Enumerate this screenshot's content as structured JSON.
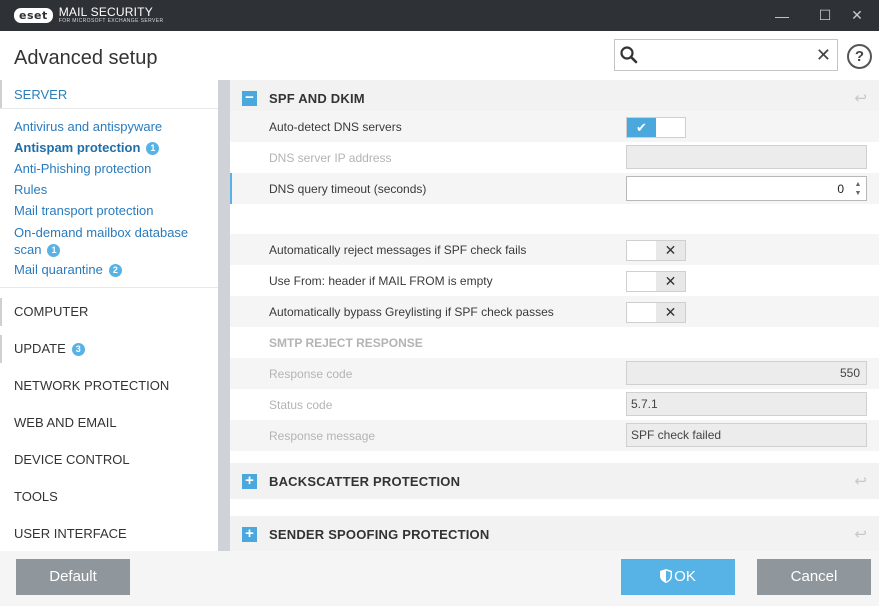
{
  "titlebar": {
    "brand": "eset",
    "product": "MAIL SECURITY",
    "product_sub": "FOR MICROSOFT EXCHANGE SERVER",
    "minimize_glyph": "—",
    "maximize_glyph": "☐",
    "close_glyph": "✕"
  },
  "header": {
    "title": "Advanced setup",
    "search_value": "",
    "search_clear_glyph": "✕",
    "help_glyph": "?"
  },
  "sidebar": {
    "sections": [
      {
        "label": "SERVER",
        "active": true
      },
      {
        "label": "COMPUTER"
      },
      {
        "label": "UPDATE",
        "badge": "3"
      },
      {
        "label": "NETWORK PROTECTION"
      },
      {
        "label": "WEB AND EMAIL"
      },
      {
        "label": "DEVICE CONTROL"
      },
      {
        "label": "TOOLS"
      },
      {
        "label": "USER INTERFACE"
      }
    ],
    "server_items": [
      {
        "label": "Antivirus and antispyware"
      },
      {
        "label": "Antispam protection",
        "badge": "1",
        "selected": true
      },
      {
        "label": "Anti-Phishing protection"
      },
      {
        "label": "Rules"
      },
      {
        "label": "Mail transport protection"
      },
      {
        "label": "On-demand mailbox database",
        "label2": "scan",
        "badge": "1"
      },
      {
        "label": "Mail quarantine",
        "badge": "2"
      }
    ]
  },
  "main": {
    "spf": {
      "title": "SPF AND DKIM",
      "toggle_glyph": "−",
      "revert_glyph": "↩",
      "rows": {
        "auto_detect": {
          "label": "Auto-detect DNS servers",
          "state": "on"
        },
        "dns_ip": {
          "label": "DNS server IP address",
          "value": ""
        },
        "dns_timeout": {
          "label": "DNS query timeout (seconds)",
          "value": "0"
        },
        "reject_spf": {
          "label": "Automatically reject messages if SPF check fails",
          "state": "off"
        },
        "use_from": {
          "label": "Use From: header if MAIL FROM is empty",
          "state": "off"
        },
        "bypass_grey": {
          "label": "Automatically bypass Greylisting if SPF check passes",
          "state": "off"
        },
        "smtp_head": {
          "label": "SMTP REJECT RESPONSE"
        },
        "resp_code": {
          "label": "Response code",
          "value": "550"
        },
        "status_code": {
          "label": "Status code",
          "value": "5.7.1"
        },
        "resp_msg": {
          "label": "Response message",
          "value": "SPF check failed"
        }
      },
      "check_glyph": "✔",
      "x_glyph": "✕",
      "spin_up": "▲",
      "spin_down": "▼"
    },
    "backscatter": {
      "title": "BACKSCATTER PROTECTION",
      "toggle_glyph": "+",
      "revert_glyph": "↩"
    },
    "sender_spoofing": {
      "title": "SENDER SPOOFING PROTECTION",
      "toggle_glyph": "+",
      "revert_glyph": "↩"
    }
  },
  "footer": {
    "default_label": "Default",
    "ok_label": "OK",
    "cancel_label": "Cancel"
  },
  "colors": {
    "titlebar": "#2e3236",
    "accent": "#57b2e6",
    "link": "#2a7bbd",
    "button_gray": "#8f969c"
  }
}
